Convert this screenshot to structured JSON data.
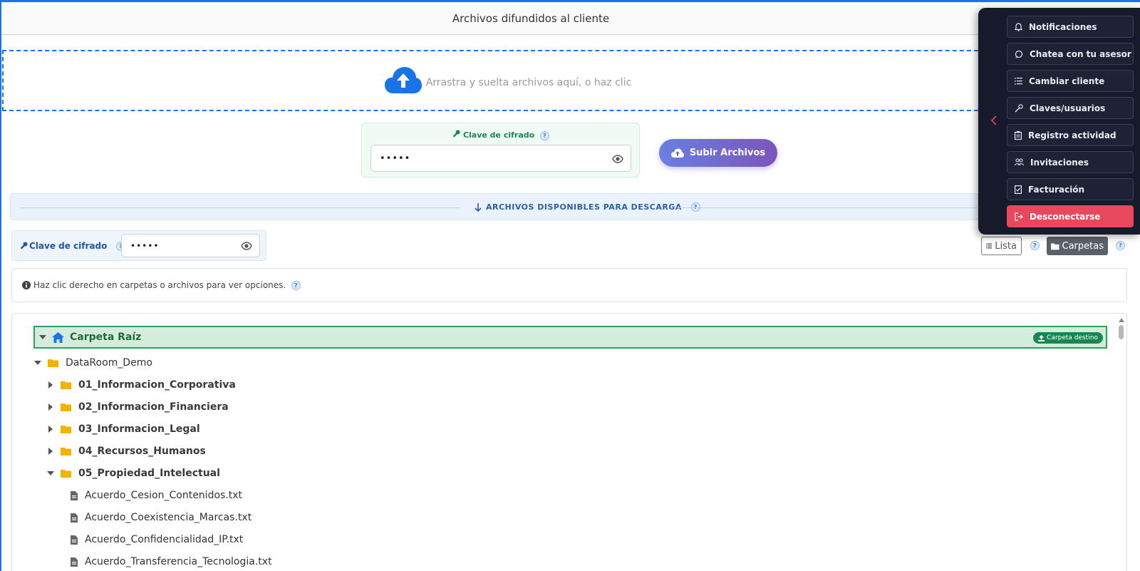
{
  "header": {
    "title": "Archivos difundidos al cliente"
  },
  "upload": {
    "dropzone_text": "Arrastra y suelta archivos aquí, o haz clic",
    "key_label": "Clave de cifrado",
    "key_value": "•••••",
    "upload_button": "Subir Archivos"
  },
  "download": {
    "section_title": "ARCHIVOS DISPONIBLES PARA DESCARGA",
    "key_label": "Clave de cifrado",
    "key_value": "•••••",
    "view_list": "Lista",
    "view_folders": "Carpetas",
    "selected_view": "Carpetas",
    "info_text": "Haz clic derecho en carpetas o archivos para ver opciones."
  },
  "help_mark": "?",
  "tree": {
    "root_label": "Carpeta Raíz",
    "root_badge": "Carpeta destino",
    "items": [
      {
        "label": "DataRoom_Demo",
        "kind": "folder",
        "state": "expanded"
      },
      {
        "label": "01_Informacion_Corporativa",
        "kind": "folder",
        "state": "collapsed"
      },
      {
        "label": "02_Informacion_Financiera",
        "kind": "folder",
        "state": "collapsed"
      },
      {
        "label": "03_Informacion_Legal",
        "kind": "folder",
        "state": "collapsed"
      },
      {
        "label": "04_Recursos_Humanos",
        "kind": "folder",
        "state": "collapsed"
      },
      {
        "label": "05_Propiedad_Intelectual",
        "kind": "folder",
        "state": "expanded"
      },
      {
        "label": "Acuerdo_Cesion_Contenidos.txt",
        "kind": "file"
      },
      {
        "label": "Acuerdo_Coexistencia_Marcas.txt",
        "kind": "file"
      },
      {
        "label": "Acuerdo_Confidencialidad_IP.txt",
        "kind": "file"
      },
      {
        "label": "Acuerdo_Transferencia_Tecnologia.txt",
        "kind": "file"
      }
    ]
  },
  "menu": {
    "items": [
      {
        "label": "Notificaciones",
        "icon": "bell-icon"
      },
      {
        "label": "Chatea con tu asesor",
        "icon": "chat-icon"
      },
      {
        "label": "Cambiar cliente",
        "icon": "list-icon"
      },
      {
        "label": "Claves/usuarios",
        "icon": "key-icon"
      },
      {
        "label": "Registro actividad",
        "icon": "clipboard-icon"
      },
      {
        "label": "Invitaciones",
        "icon": "people-icon"
      },
      {
        "label": "Facturación",
        "icon": "invoice-icon"
      },
      {
        "label": "Desconectarse",
        "icon": "logout-icon"
      }
    ]
  },
  "colors": {
    "accent": "#1a73e8",
    "success": "#198754",
    "panel_bg": "#161a2a",
    "logout": "#e8475c",
    "folder": "#f5b301"
  }
}
